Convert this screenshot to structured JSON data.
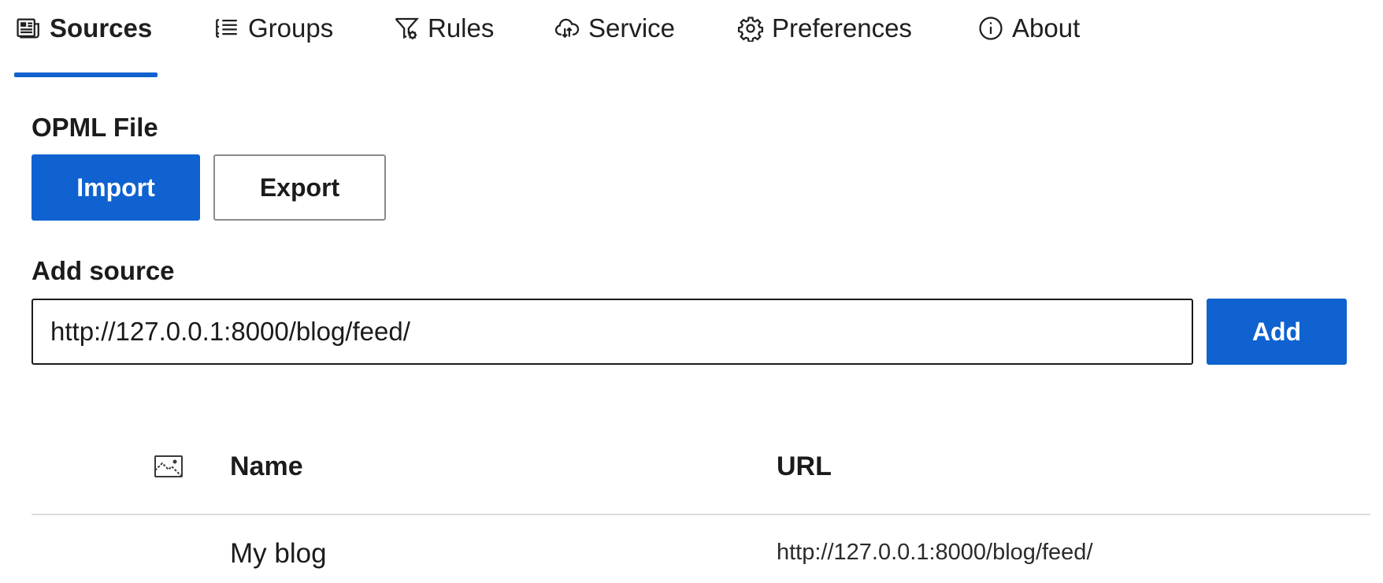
{
  "tabs": [
    {
      "label": "Sources",
      "icon": "sources-icon",
      "active": true
    },
    {
      "label": "Groups",
      "icon": "list-icon",
      "active": false
    },
    {
      "label": "Rules",
      "icon": "filter-settings-icon",
      "active": false
    },
    {
      "label": "Service",
      "icon": "cloud-sync-icon",
      "active": false
    },
    {
      "label": "Preferences",
      "icon": "gear-icon",
      "active": false
    },
    {
      "label": "About",
      "icon": "info-icon",
      "active": false
    }
  ],
  "opml": {
    "title": "OPML File",
    "import_label": "Import",
    "export_label": "Export"
  },
  "add_source": {
    "title": "Add source",
    "input_value": "http://127.0.0.1:8000/blog/feed/",
    "add_label": "Add"
  },
  "table": {
    "icon_column": "image-icon",
    "columns": [
      "Name",
      "URL"
    ],
    "rows": [
      {
        "name": "My blog",
        "url": "http://127.0.0.1:8000/blog/feed/"
      }
    ]
  },
  "colors": {
    "accent": "#0f62d0",
    "text": "#1b1b1b",
    "divider": "#dcdcdc"
  }
}
